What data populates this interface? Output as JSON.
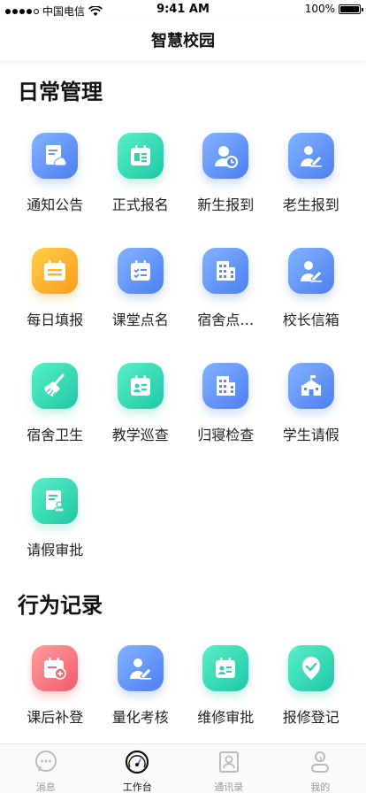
{
  "status": {
    "carrier": "中国电信",
    "time": "9:41 AM",
    "battery": "100%"
  },
  "header": {
    "title": "智慧校园"
  },
  "sections": [
    {
      "title": "日常管理",
      "items": [
        {
          "label": "通知公告",
          "icon": "notice-icon",
          "color": "blue"
        },
        {
          "label": "正式报名",
          "icon": "registration-form-icon",
          "color": "teal"
        },
        {
          "label": "新生报到",
          "icon": "new-student-icon",
          "color": "blue"
        },
        {
          "label": "老生报到",
          "icon": "returning-student-icon",
          "color": "blue"
        },
        {
          "label": "每日填报",
          "icon": "calendar-icon",
          "color": "orange"
        },
        {
          "label": "课堂点名",
          "icon": "roll-call-icon",
          "color": "blue"
        },
        {
          "label": "宿舍点…",
          "icon": "dorm-building-icon",
          "color": "blue"
        },
        {
          "label": "校长信箱",
          "icon": "mailbox-icon",
          "color": "blue"
        },
        {
          "label": "宿舍卫生",
          "icon": "broom-icon",
          "color": "teal"
        },
        {
          "label": "教学巡查",
          "icon": "inspection-icon",
          "color": "teal"
        },
        {
          "label": "归寝检查",
          "icon": "building-check-icon",
          "color": "blue"
        },
        {
          "label": "学生请假",
          "icon": "school-icon",
          "color": "blue"
        },
        {
          "label": "请假审批",
          "icon": "approval-icon",
          "color": "teal"
        }
      ]
    },
    {
      "title": "行为记录",
      "items": [
        {
          "label": "课后补登",
          "icon": "calendar-add-icon",
          "color": "red"
        },
        {
          "label": "量化考核",
          "icon": "assessment-icon",
          "color": "blue"
        },
        {
          "label": "维修审批",
          "icon": "repair-approval-icon",
          "color": "teal"
        },
        {
          "label": "报修登记",
          "icon": "repair-register-icon",
          "color": "teal"
        }
      ]
    }
  ],
  "tabs": [
    {
      "label": "消息",
      "icon": "message-icon",
      "active": false
    },
    {
      "label": "工作台",
      "icon": "dashboard-icon",
      "active": true
    },
    {
      "label": "通讯录",
      "icon": "contacts-icon",
      "active": false
    },
    {
      "label": "我的",
      "icon": "profile-icon",
      "active": false
    }
  ]
}
